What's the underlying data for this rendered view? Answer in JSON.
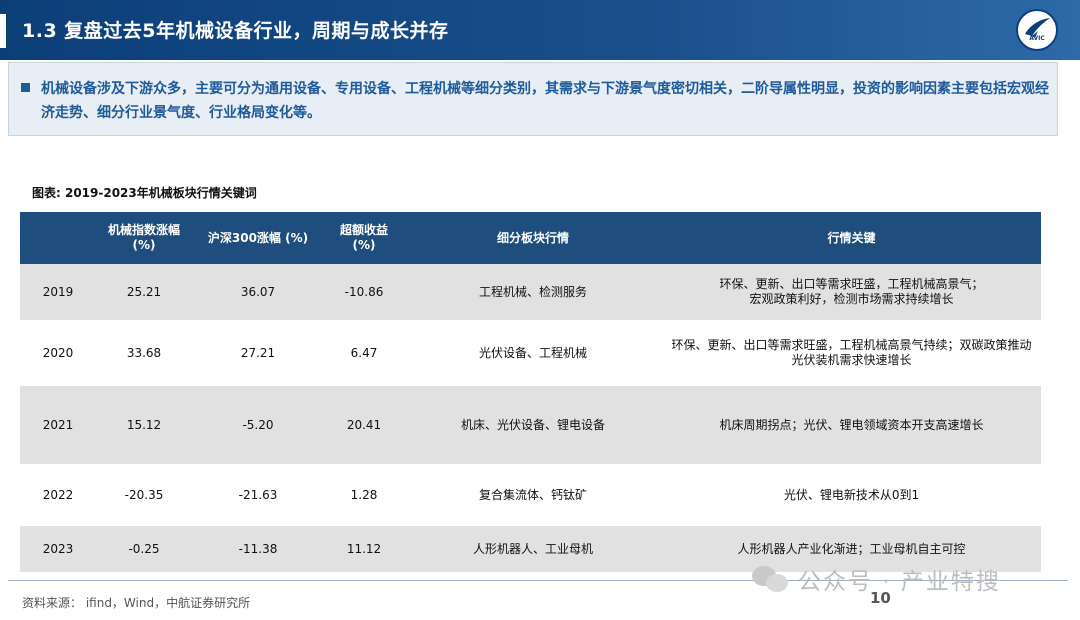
{
  "header": {
    "title": "1.3 复盘过去5年机械设备行业，周期与成长并存",
    "logo_text": "AVIC"
  },
  "intro": {
    "text": "机械设备涉及下游众多，主要可分为通用设备、专用设备、工程机械等细分类别，其需求与下游景气度密切相关，二阶导属性明显，投资的影响因素主要包括宏观经济走势、细分行业景气度、行业格局变化等。"
  },
  "figure": {
    "caption": "图表:   2019-2023年机械板块行情关键词"
  },
  "table": {
    "headers": [
      "",
      "机械指数涨幅\n(%)",
      "沪深300涨幅  (%)",
      "超额收益\n(%)",
      "细分板块行情",
      "行情关键"
    ],
    "rows": [
      [
        "2019",
        "25.21",
        "36.07",
        "-10.86",
        "工程机械、检测服务",
        "环保、更新、出口等需求旺盛，工程机械高景气；\n宏观政策利好，检测市场需求持续增长"
      ],
      [
        "2020",
        "33.68",
        "27.21",
        "6.47",
        "光伏设备、工程机械",
        "环保、更新、出口等需求旺盛，工程机械高景气持续；双碳政策推动光伏装机需求快速增长"
      ],
      [
        "2021",
        "15.12",
        "-5.20",
        "20.41",
        "机床、光伏设备、锂电设备",
        "机床周期拐点；光伏、锂电领域资本开支高速增长"
      ],
      [
        "2022",
        "-20.35",
        "-21.63",
        "1.28",
        "复合集流体、钙钛矿",
        "光伏、锂电新技术从0到1"
      ],
      [
        "2023",
        "-0.25",
        "-11.38",
        "11.12",
        "人形机器人、工业母机",
        "人形机器人产业化渐进；工业母机自主可控"
      ]
    ]
  },
  "footer": {
    "source": "资料来源：  ifind，Wind，中航证券研究所",
    "page_number": "10",
    "watermark": "公众号 · 产业特搜"
  },
  "colors": {
    "title_bar": "#0c3f78",
    "table_header": "#1f4d7e",
    "shaded_row": "#e1e1e1",
    "intro_text": "#1f5a9a"
  }
}
